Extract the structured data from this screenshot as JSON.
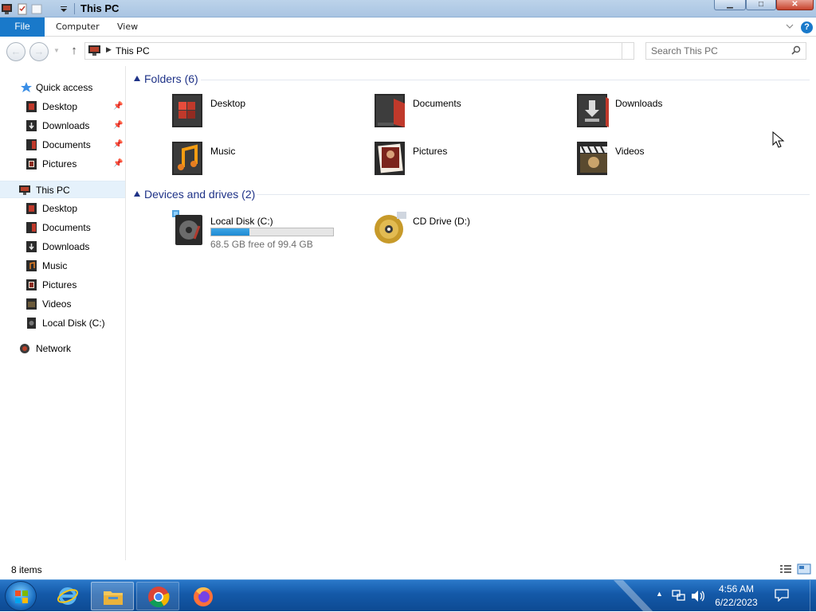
{
  "window": {
    "title": "This PC",
    "controls": {
      "minimize": "▁",
      "maximize": "□",
      "close": "✕"
    }
  },
  "ribbon": {
    "tabs": [
      "File",
      "Computer",
      "View"
    ],
    "help": "?"
  },
  "navbar": {
    "address_crumb": "This PC",
    "search_placeholder": "Search This PC"
  },
  "navpane": {
    "quick_access": "Quick access",
    "quick_items": [
      "Desktop",
      "Downloads",
      "Documents",
      "Pictures"
    ],
    "this_pc": "This PC",
    "pc_items": [
      "Desktop",
      "Documents",
      "Downloads",
      "Music",
      "Pictures",
      "Videos",
      "Local Disk (C:)"
    ],
    "network": "Network"
  },
  "content": {
    "folders_header": "Folders (6)",
    "folders": [
      "Desktop",
      "Documents",
      "Downloads",
      "Music",
      "Pictures",
      "Videos"
    ],
    "drives_header": "Devices and drives (2)",
    "drives": [
      {
        "name": "Local Disk (C:)",
        "free_text": "68.5 GB free of 99.4 GB",
        "used_fraction": 0.311
      },
      {
        "name": "CD Drive (D:)"
      }
    ]
  },
  "statusbar": {
    "items_text": "8 items"
  },
  "taskbar": {
    "apps": [
      "internet-explorer",
      "file-explorer",
      "chrome",
      "firefox"
    ],
    "clock_time": "4:56 AM",
    "clock_date": "6/22/2023"
  },
  "colors": {
    "accent": "#1979ca",
    "group_header": "#1e3287",
    "drive_bar": "#26a0da",
    "taskbar": "#1459a8"
  }
}
